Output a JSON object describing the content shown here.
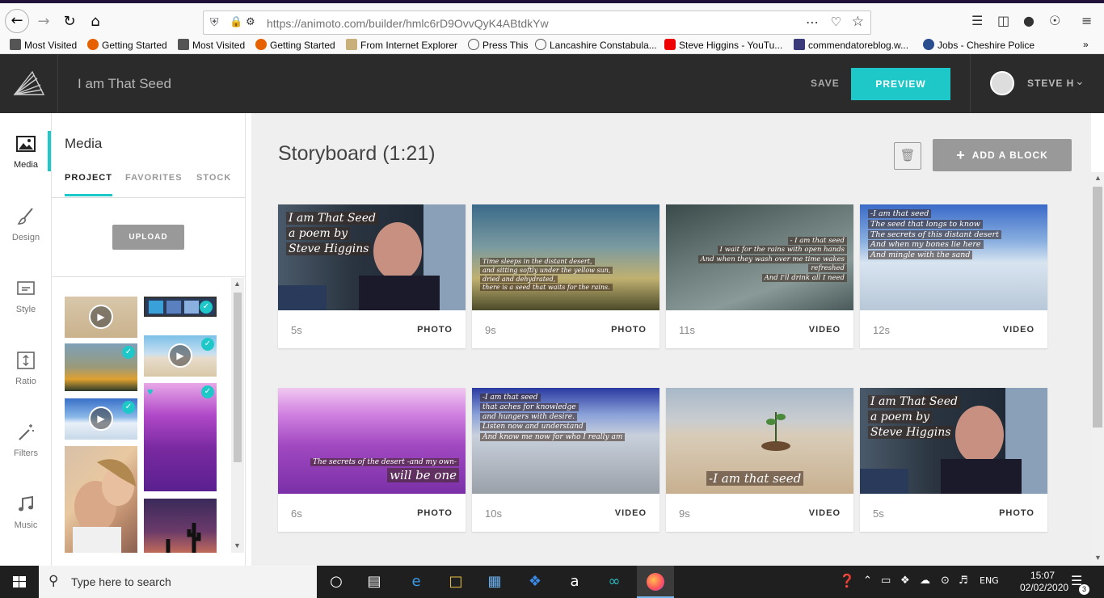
{
  "browser": {
    "url": "https://animoto.com/builder/hmlc6rD9OvvQyK4ABtdkYw",
    "bookmarks": [
      {
        "label": "Most Visited",
        "icon": "gear-icon"
      },
      {
        "label": "Getting Started",
        "icon": "firefox-icon"
      },
      {
        "label": "Most Visited",
        "icon": "gear-icon"
      },
      {
        "label": "Getting Started",
        "icon": "firefox-icon"
      },
      {
        "label": "From Internet Explorer",
        "icon": "folder-icon"
      },
      {
        "label": "Press This",
        "icon": "globe-icon"
      },
      {
        "label": "Lancashire Constabula...",
        "icon": "globe-icon"
      },
      {
        "label": "Steve Higgins - YouTu...",
        "icon": "youtube-icon"
      },
      {
        "label": "commendatoreblog.w...",
        "icon": "blog-icon"
      },
      {
        "label": "Jobs - Cheshire Police",
        "icon": "police-icon"
      }
    ],
    "overflow": "»"
  },
  "app": {
    "project_title": "I am That Seed",
    "save_label": "SAVE",
    "preview_label": "PREVIEW",
    "user_name": "STEVE H",
    "accent_color": "#1ec8c8"
  },
  "left_nav": [
    {
      "label": "Media",
      "icon": "image-icon"
    },
    {
      "label": "Design",
      "icon": "brush-icon"
    },
    {
      "label": "Style",
      "icon": "style-icon"
    },
    {
      "label": "Ratio",
      "icon": "ratio-icon"
    },
    {
      "label": "Filters",
      "icon": "magic-wand-icon"
    },
    {
      "label": "Music",
      "icon": "music-note-icon"
    }
  ],
  "media_panel": {
    "title": "Media",
    "tabs": [
      "PROJECT",
      "FAVORITES",
      "STOCK"
    ],
    "active_tab": "PROJECT",
    "upload_label": "UPLOAD"
  },
  "storyboard": {
    "title": "Storyboard (1:21)",
    "add_block_label": "ADD A BLOCK",
    "blocks": [
      {
        "duration": "5s",
        "type": "PHOTO",
        "lines": [
          "I am That Seed",
          "a poem by",
          "Steve Higgins"
        ]
      },
      {
        "duration": "9s",
        "type": "PHOTO",
        "lines": [
          "Time sleeps in the distant desert,",
          "and sitting softly under the yellow sun,",
          "dried and dehydrated,",
          "there is a seed that waits for the rains."
        ]
      },
      {
        "duration": "11s",
        "type": "VIDEO",
        "lines": [
          "- I am that seed",
          "I wait for the rains with open hands",
          "And when they wash over me time wakes",
          "refreshed",
          "And I'll drink all I need"
        ]
      },
      {
        "duration": "12s",
        "type": "VIDEO",
        "lines": [
          "-I am that seed",
          "The seed that longs to know",
          "The secrets of this distant desert",
          "And when my bones lie here",
          "And mingle with the sand"
        ]
      },
      {
        "duration": "6s",
        "type": "PHOTO",
        "lines": [
          "The secrets of the desert -and my own-",
          "will be one"
        ]
      },
      {
        "duration": "10s",
        "type": "VIDEO",
        "lines": [
          "-I am that seed",
          "that aches for knowledge",
          "and hungers with desire.",
          "Listen now and understand",
          "And know me now for who I really am"
        ]
      },
      {
        "duration": "9s",
        "type": "VIDEO",
        "lines": [
          "-I am that seed"
        ]
      },
      {
        "duration": "5s",
        "type": "PHOTO",
        "lines": [
          "I am That Seed",
          "a poem by",
          "Steve Higgins"
        ]
      }
    ]
  },
  "taskbar": {
    "search_placeholder": "Type here to search",
    "language": "ENG",
    "time": "15:07",
    "date": "02/02/2020",
    "notification_count": "3"
  }
}
